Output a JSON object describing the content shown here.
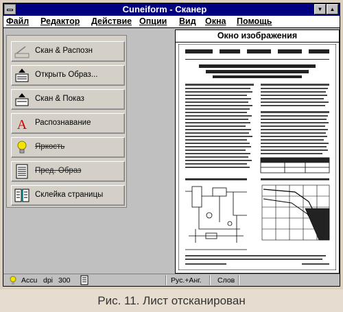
{
  "window": {
    "title": "Cuneiform - Сканер",
    "minimize_glyph": "▼",
    "maximize_glyph": "▲"
  },
  "menu": [
    "Файл",
    "Редактор",
    "Действие",
    "Опции",
    "Вид",
    "Окна",
    "Помощь"
  ],
  "sidebar": {
    "buttons": [
      {
        "label": "Скан & Распозн",
        "icon": "scanner-icon",
        "disabled": false
      },
      {
        "label": "Открыть Образ...",
        "icon": "open-image-icon",
        "disabled": false
      },
      {
        "label": "Скан & Показ",
        "icon": "scan-show-icon",
        "disabled": false
      },
      {
        "label": "Распознавание",
        "icon": "recognize-icon",
        "disabled": false
      },
      {
        "label": "Яркость",
        "icon": "bulb-icon",
        "disabled": true
      },
      {
        "label": "Пред. Образ",
        "icon": "prev-image-icon",
        "disabled": true
      },
      {
        "label": "Склейка страницы",
        "icon": "glue-pages-icon",
        "disabled": false
      }
    ]
  },
  "image_window": {
    "title": "Окно изображения"
  },
  "status": {
    "mode": "Accu",
    "dpi_label": "dpi",
    "dpi_value": "300",
    "language": "Рус.+Анг.",
    "dictionary": "Слов"
  },
  "caption": "Рис. 11. Лист отсканирован",
  "colors": {
    "titlebar": "#000080",
    "window_bg": "#c0c0c0",
    "frame_bg": "#dcd1bf"
  }
}
